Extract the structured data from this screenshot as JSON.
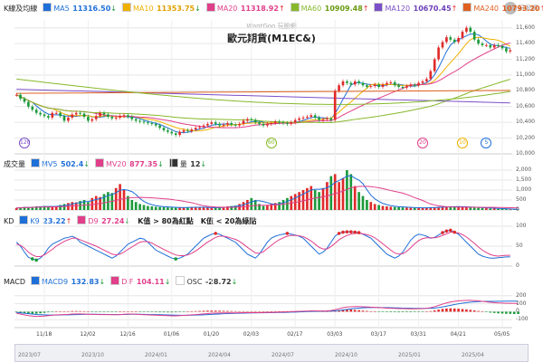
{
  "logo_text": "玩股網",
  "watermark": "WantGoo 玩股網",
  "title": "歐元期貨(M1EC&)",
  "legends": {
    "ma": {
      "head": "K線及均線",
      "items": [
        {
          "label": "MA5",
          "value": "11316.50",
          "arrow": "↓",
          "color": "#1f6fd8",
          "val_color": "#1f6fd8"
        },
        {
          "label": "MA10",
          "value": "11353.75",
          "arrow": "↓",
          "color": "#f0b000",
          "val_color": "#e0a000"
        },
        {
          "label": "MA20",
          "value": "11318.92",
          "arrow": "↑",
          "color": "#e03f8a",
          "val_color": "#e03f8a"
        },
        {
          "label": "MA60",
          "value": "10909.48",
          "arrow": "↑",
          "color": "#86b82a",
          "val_color": "#6a9a10"
        },
        {
          "label": "MA120",
          "value": "10670.45",
          "arrow": "↑",
          "color": "#7b4fc8",
          "val_color": "#6b3fb8"
        },
        {
          "label": "MA240",
          "value": "10793.20",
          "arrow": "↑",
          "color": "#e06020",
          "val_color": "#e06020"
        }
      ]
    },
    "vol": {
      "head": "成交量",
      "items": [
        {
          "label": "MV5",
          "value": "502.4",
          "arrow": "↓",
          "color": "#1f6fd8",
          "val_color": "#1f6fd8"
        },
        {
          "label": "MV20",
          "value": "877.35",
          "arrow": "↓",
          "color": "#e03f8a",
          "val_color": "#e03f8a"
        },
        {
          "label": "量",
          "value": "12",
          "arrow": "↓",
          "color": "#333",
          "val_color": "#333"
        }
      ]
    },
    "kd": {
      "head": "KD",
      "items": [
        {
          "label": "K9",
          "value": "23.22",
          "arrow": "↑",
          "color": "#1f6fd8",
          "val_color": "#1f6fd8"
        },
        {
          "label": "D9",
          "value": "27.24",
          "arrow": "↓",
          "color": "#e03f8a",
          "val_color": "#e03f8a"
        }
      ],
      "notes": [
        "K值 > 80為紅點",
        "K值 < 20為綠點"
      ]
    },
    "macd": {
      "head": "MACD",
      "items": [
        {
          "label": "MACD9",
          "value": "132.83",
          "arrow": "↓",
          "color": "#1f6fd8",
          "val_color": "#1f6fd8"
        },
        {
          "label": "DIF",
          "value": "104.11",
          "arrow": "↓",
          "color": "#e03f8a",
          "val_color": "#e03f8a"
        },
        {
          "label": "OSC",
          "value": "-28.72",
          "arrow": "↓",
          "color": "#fff",
          "val_color": "#333"
        }
      ]
    }
  },
  "dates": [
    "11/18",
    "12/02",
    "12/16",
    "01/06",
    "01/20",
    "02/03",
    "02/17",
    "03/03",
    "03/17",
    "03/31",
    "04/21",
    "05/05"
  ],
  "nav_years": [
    "2023/07",
    "2023/10",
    "2024/01",
    "2024/04",
    "2024/07",
    "2024/10",
    "2025/01",
    "2025/04"
  ],
  "badges": [
    {
      "text": "120",
      "color": "#7b4fc8",
      "index": 2
    },
    {
      "text": "60",
      "color": "#86b82a",
      "index": 64
    },
    {
      "text": "20",
      "color": "#e03f8a",
      "index": 102
    },
    {
      "text": "10",
      "color": "#f0b000",
      "index": 112
    },
    {
      "text": "5",
      "color": "#1f6fd8",
      "index": 118
    }
  ],
  "colors": {
    "up": "#e02a2a",
    "down": "#1b9a3a",
    "grid": "#e6e6e6"
  },
  "chart_data": {
    "type": "line",
    "price_axis": {
      "ylim": [
        10000,
        11700
      ],
      "ticks": [
        10000,
        10200,
        10400,
        10600,
        10800,
        11000,
        11200,
        11400,
        11600
      ]
    },
    "volume_axis": {
      "ylim": [
        0,
        2000
      ],
      "ticks": [
        0,
        500,
        1000,
        1500,
        2000
      ]
    },
    "kd_axis": {
      "ylim": [
        0,
        100
      ],
      "ticks": [
        0,
        50,
        100
      ]
    },
    "macd_axis": {
      "ylim": [
        -200,
        300
      ],
      "ticks": [
        -100,
        0,
        100,
        200
      ]
    },
    "close": [
      10750,
      10700,
      10660,
      10600,
      10560,
      10520,
      10500,
      10480,
      10460,
      10520,
      10520,
      10480,
      10420,
      10460,
      10500,
      10520,
      10510,
      10470,
      10420,
      10440,
      10480,
      10520,
      10500,
      10470,
      10450,
      10460,
      10480,
      10490,
      10470,
      10440,
      10420,
      10410,
      10400,
      10390,
      10380,
      10360,
      10330,
      10300,
      10280,
      10260,
      10240,
      10280,
      10300,
      10290,
      10310,
      10330,
      10340,
      10360,
      10380,
      10400,
      10380,
      10360,
      10370,
      10390,
      10370,
      10360,
      10380,
      10420,
      10440,
      10430,
      10400,
      10380,
      10360,
      10380,
      10390,
      10410,
      10400,
      10390,
      10380,
      10400,
      10430,
      10450,
      10460,
      10470,
      10490,
      10460,
      10430,
      10440,
      10450,
      10430,
      10800,
      10870,
      10920,
      10900,
      10880,
      10920,
      10900,
      10870,
      10850,
      10860,
      10880,
      10850,
      10880,
      10900,
      10910,
      10870,
      10850,
      10840,
      10860,
      10880,
      10870,
      10900,
      10920,
      10950,
      11050,
      11200,
      11350,
      11420,
      11480,
      11450,
      11420,
      11470,
      11550,
      11600,
      11550,
      11450,
      11400,
      11380,
      11380,
      11350,
      11380,
      11370,
      11340,
      11300,
      11316
    ],
    "volume": [
      100,
      120,
      150,
      130,
      160,
      180,
      170,
      200,
      180,
      160,
      200,
      250,
      300,
      350,
      400,
      380,
      450,
      500,
      400,
      600,
      700,
      650,
      800,
      900,
      850,
      1100,
      1300,
      1000,
      700,
      500,
      400,
      300,
      250,
      200,
      180,
      160,
      150,
      140,
      130,
      120,
      110,
      120,
      130,
      140,
      150,
      140,
      130,
      120,
      110,
      100,
      120,
      140,
      160,
      180,
      200,
      220,
      300,
      400,
      500,
      600,
      500,
      300,
      200,
      250,
      300,
      350,
      400,
      500,
      600,
      700,
      800,
      900,
      1000,
      1100,
      1200,
      1000,
      900,
      1100,
      1400,
      1700,
      1800,
      1400,
      1600,
      2000,
      1800,
      1200,
      900,
      700,
      500,
      400,
      300,
      250,
      200,
      180,
      160,
      150,
      140,
      130,
      120,
      110,
      100,
      100,
      110,
      120,
      130,
      140,
      150,
      160,
      170,
      180,
      170,
      160,
      150,
      140,
      130,
      120,
      110,
      100,
      90,
      80,
      70,
      60,
      50,
      40,
      30,
      20,
      12
    ],
    "k": [
      60,
      50,
      35,
      22,
      18,
      15,
      20,
      30,
      45,
      55,
      60,
      65,
      70,
      72,
      75,
      70,
      60,
      55,
      50,
      45,
      40,
      35,
      30,
      25,
      20,
      25,
      35,
      45,
      55,
      60,
      65,
      70,
      68,
      60,
      50,
      40,
      35,
      30,
      25,
      20,
      18,
      20,
      25,
      30,
      40,
      50,
      60,
      70,
      75,
      80,
      82,
      80,
      75,
      70,
      65,
      60,
      50,
      40,
      30,
      25,
      20,
      30,
      45,
      60,
      70,
      75,
      78,
      80,
      82,
      80,
      78,
      75,
      70,
      60,
      50,
      40,
      30,
      35,
      45,
      60,
      75,
      82,
      85,
      86,
      86,
      85,
      84,
      80,
      75,
      70,
      60,
      50,
      40,
      30,
      25,
      20,
      25,
      35,
      50,
      65,
      75,
      80,
      78,
      75,
      70,
      72,
      78,
      84,
      88,
      90,
      85,
      80,
      70,
      60,
      50,
      40,
      30,
      25,
      22,
      20,
      20,
      21,
      22,
      23,
      23
    ],
    "d": [
      55,
      52,
      45,
      35,
      28,
      24,
      24,
      28,
      35,
      42,
      50,
      56,
      62,
      66,
      70,
      70,
      66,
      62,
      58,
      54,
      50,
      45,
      40,
      35,
      30,
      28,
      30,
      35,
      42,
      48,
      54,
      60,
      62,
      61,
      58,
      52,
      47,
      42,
      37,
      32,
      28,
      26,
      26,
      28,
      32,
      38,
      45,
      53,
      60,
      66,
      72,
      75,
      75,
      73,
      70,
      67,
      62,
      55,
      47,
      40,
      33,
      32,
      36,
      44,
      52,
      60,
      66,
      71,
      75,
      77,
      77,
      76,
      74,
      69,
      63,
      55,
      47,
      43,
      43,
      49,
      57,
      66,
      72,
      77,
      80,
      82,
      82,
      81,
      79,
      76,
      71,
      64,
      56,
      48,
      40,
      33,
      30,
      31,
      37,
      46,
      56,
      64,
      69,
      71,
      71,
      71,
      73,
      77,
      81,
      85,
      85,
      83,
      79,
      73,
      65,
      57,
      48,
      40,
      34,
      29,
      26,
      25,
      26,
      27,
      27
    ],
    "dif": [
      -20,
      -30,
      -40,
      -50,
      -55,
      -60,
      -58,
      -55,
      -50,
      -45,
      -40,
      -38,
      -36,
      -34,
      -30,
      -28,
      -28,
      -30,
      -32,
      -34,
      -35,
      -36,
      -36,
      -37,
      -38,
      -38,
      -36,
      -33,
      -30,
      -30,
      -32,
      -35,
      -38,
      -40,
      -42,
      -44,
      -46,
      -48,
      -50,
      -52,
      -52,
      -50,
      -47,
      -44,
      -40,
      -36,
      -32,
      -28,
      -24,
      -20,
      -18,
      -17,
      -16,
      -15,
      -15,
      -15,
      -14,
      -13,
      -12,
      -12,
      -12,
      -12,
      -11,
      -10,
      -9,
      -8,
      -6,
      -4,
      -2,
      0,
      2,
      4,
      6,
      8,
      10,
      10,
      9,
      9,
      10,
      14,
      25,
      38,
      50,
      58,
      62,
      64,
      64,
      62,
      60,
      57,
      54,
      51,
      48,
      45,
      43,
      41,
      39,
      38,
      37,
      36,
      36,
      37,
      39,
      43,
      50,
      62,
      78,
      95,
      110,
      122,
      130,
      136,
      140,
      142,
      142,
      140,
      136,
      130,
      124,
      118,
      114,
      110,
      108,
      106,
      105,
      104,
      104
    ],
    "macd9": [
      -10,
      -15,
      -20,
      -25,
      -30,
      -35,
      -38,
      -40,
      -42,
      -42,
      -42,
      -41,
      -40,
      -39,
      -38,
      -36,
      -35,
      -34,
      -33,
      -33,
      -33,
      -34,
      -34,
      -35,
      -35,
      -36,
      -36,
      -35,
      -34,
      -33,
      -33,
      -33,
      -34,
      -35,
      -36,
      -37,
      -38,
      -40,
      -41,
      -43,
      -44,
      -45,
      -45,
      -45,
      -44,
      -43,
      -41,
      -39,
      -37,
      -34,
      -31,
      -29,
      -26,
      -24,
      -22,
      -21,
      -19,
      -18,
      -17,
      -16,
      -15,
      -14,
      -14,
      -13,
      -12,
      -11,
      -10,
      -9,
      -8,
      -6,
      -5,
      -3,
      -1,
      1,
      3,
      4,
      5,
      6,
      7,
      8,
      11,
      16,
      22,
      29,
      35,
      41,
      45,
      49,
      51,
      52,
      53,
      53,
      52,
      51,
      50,
      48,
      47,
      45,
      44,
      43,
      42,
      41,
      41,
      41,
      43,
      46,
      52,
      60,
      70,
      80,
      90,
      99,
      107,
      114,
      119,
      124,
      127,
      129,
      130,
      130,
      130,
      131,
      131,
      132,
      132,
      133,
      133
    ]
  }
}
